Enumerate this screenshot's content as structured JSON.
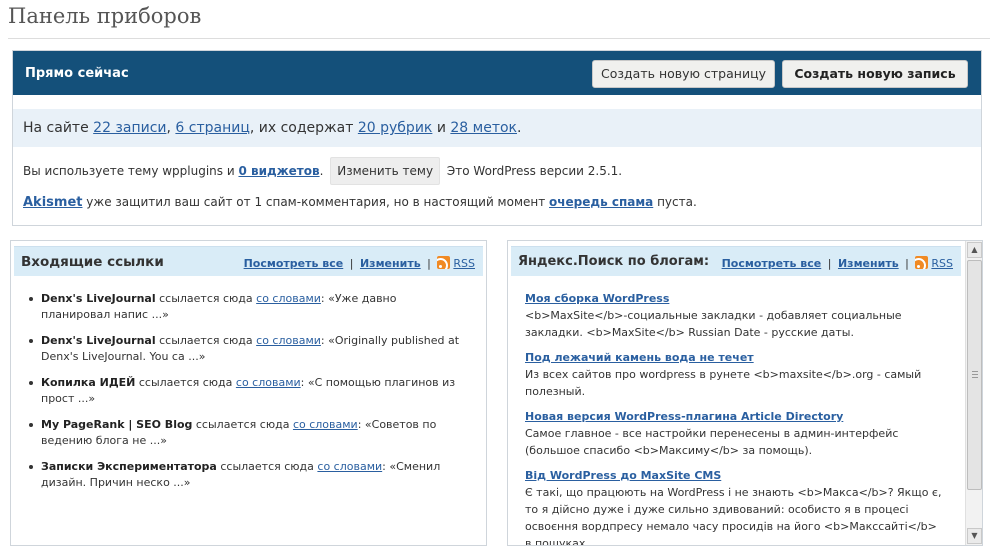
{
  "page": {
    "title": "Панель приборов"
  },
  "right_now": {
    "title": "Прямо сейчас",
    "new_page_button": "Создать новую страницу",
    "new_post_button": "Создать новую запись",
    "stats": {
      "prefix": "На сайте ",
      "posts_link": "22 записи",
      "sep1": ", ",
      "pages_link": "6 страниц",
      "middle": ", их содержат ",
      "categories_link": "20 рубрик",
      "and": " и ",
      "tags_link": "28 меток",
      "end": "."
    },
    "theme": {
      "prefix": "Вы используете тему wpplugins и ",
      "widgets_link": "0 виджетов",
      "dot": ".",
      "change_theme_button": "Изменить тему",
      "version_text": "Это WordPress версии 2.5.1."
    },
    "akismet": {
      "link": "Akismet",
      "middle": " уже защитил ваш сайт от 1 спам-комментария, но в настоящий момент ",
      "queue_link": "очередь спама",
      "end": " пуста."
    }
  },
  "inbound_links": {
    "title": "Входящие ссылки",
    "view_all": "Посмотреть все",
    "sep": "|",
    "edit": "Изменить",
    "rss": "RSS",
    "items": [
      {
        "site": "Denx's LiveJournal",
        "refers": " ссылается сюда ",
        "words": "со словами",
        "quote": ": «Уже давно планировал напис ...»"
      },
      {
        "site": "Denx's LiveJournal",
        "refers": " ссылается сюда ",
        "words": "со словами",
        "quote": ": «Originally published at Denx's LiveJournal. You ca ...»"
      },
      {
        "site": "Копилка ИДЕЙ",
        "refers": " ссылается сюда ",
        "words": "со словами",
        "quote": ": «С помощью плагинов из прост ...»"
      },
      {
        "site": "My PageRank | SEO Blog",
        "refers": " ссылается сюда ",
        "words": "со словами",
        "quote": ": «Советов по ведению блога не ...»"
      },
      {
        "site": "Записки Экспериментатора",
        "refers": " ссылается сюда ",
        "words": "со словами",
        "quote": ": «Сменил дизайн. Причин неско ...»"
      }
    ]
  },
  "yandex": {
    "title": "Яндекс.Поиск по блогам:",
    "view_all": "Посмотреть все",
    "sep": "|",
    "edit": "Изменить",
    "rss": "RSS",
    "items": [
      {
        "title": "Моя сборка WordPress",
        "text": "<b>MaxSite</b>-социальные закладки - добавляет социальные закладки. <b>MaxSite</b> Russian Date - русские даты."
      },
      {
        "title": "Под лежачий камень вода не течет",
        "text": "Из всех сайтов про wordpress в рунете <b>maxsite</b>.org - самый полезный."
      },
      {
        "title": "Новая версия WordPress-плагина Article Directory",
        "text": "Самое главное - все настройки перенесены в админ-интерфейс (большое спасибо <b>Максиму</b> за помощь)."
      },
      {
        "title": "Від WordPress до MaxSite CMS",
        "text": "Є такі, що працюють на WordPress і не знають <b>Макса</b>? Якщо є, то я дійсно дуже і дуже сильно здивований: особисто я в процесі освоєння вордпресу немало часу просидів на його <b>Макссайті</b> в пошуках"
      }
    ]
  },
  "scrollbar": {
    "grip": "≡"
  }
}
